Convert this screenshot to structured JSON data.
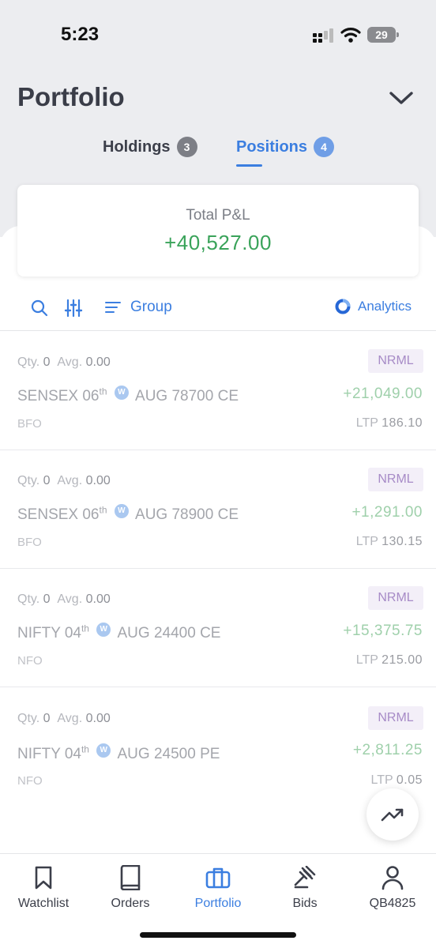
{
  "status_bar": {
    "time": "5:23",
    "battery": "29"
  },
  "header": {
    "title": "Portfolio"
  },
  "tabs": [
    {
      "label": "Holdings",
      "count": "3"
    },
    {
      "label": "Positions",
      "count": "4"
    }
  ],
  "summary": {
    "label": "Total P&L",
    "value": "+40,527.00"
  },
  "toolbar": {
    "group_label": "Group",
    "analytics_label": "Analytics"
  },
  "positions": [
    {
      "qty_label": "Qty.",
      "qty": "0",
      "avg_label": "Avg.",
      "avg": "0.00",
      "product": "NRML",
      "symbol": "SENSEX 06",
      "day_suffix": "th",
      "weekly_badge": "W",
      "contract": "AUG 78700 CE",
      "pnl": "+21,049.00",
      "exchange": "BFO",
      "ltp_label": "LTP",
      "ltp": "186.10"
    },
    {
      "qty_label": "Qty.",
      "qty": "0",
      "avg_label": "Avg.",
      "avg": "0.00",
      "product": "NRML",
      "symbol": "SENSEX 06",
      "day_suffix": "th",
      "weekly_badge": "W",
      "contract": "AUG 78900 CE",
      "pnl": "+1,291.00",
      "exchange": "BFO",
      "ltp_label": "LTP",
      "ltp": "130.15"
    },
    {
      "qty_label": "Qty.",
      "qty": "0",
      "avg_label": "Avg.",
      "avg": "0.00",
      "product": "NRML",
      "symbol": "NIFTY 04",
      "day_suffix": "th",
      "weekly_badge": "W",
      "contract": "AUG 24400 CE",
      "pnl": "+15,375.75",
      "exchange": "NFO",
      "ltp_label": "LTP",
      "ltp": "215.00"
    },
    {
      "qty_label": "Qty.",
      "qty": "0",
      "avg_label": "Avg.",
      "avg": "0.00",
      "product": "NRML",
      "symbol": "NIFTY 04",
      "day_suffix": "th",
      "weekly_badge": "W",
      "contract": "AUG 24500 PE",
      "pnl": "+2,811.25",
      "exchange": "NFO",
      "ltp_label": "LTP",
      "ltp": "0.05"
    }
  ],
  "bottom_nav": [
    {
      "label": "Watchlist",
      "icon": "bookmark-icon"
    },
    {
      "label": "Orders",
      "icon": "book-icon"
    },
    {
      "label": "Portfolio",
      "icon": "briefcase-icon",
      "active": true
    },
    {
      "label": "Bids",
      "icon": "gavel-icon"
    },
    {
      "label": "QB4825",
      "icon": "user-icon"
    }
  ],
  "colors": {
    "accent": "#3b7ee0",
    "profit": "#3aa35a",
    "profit_muted": "#9fd0ab",
    "product_badge": "#a78bc7"
  }
}
